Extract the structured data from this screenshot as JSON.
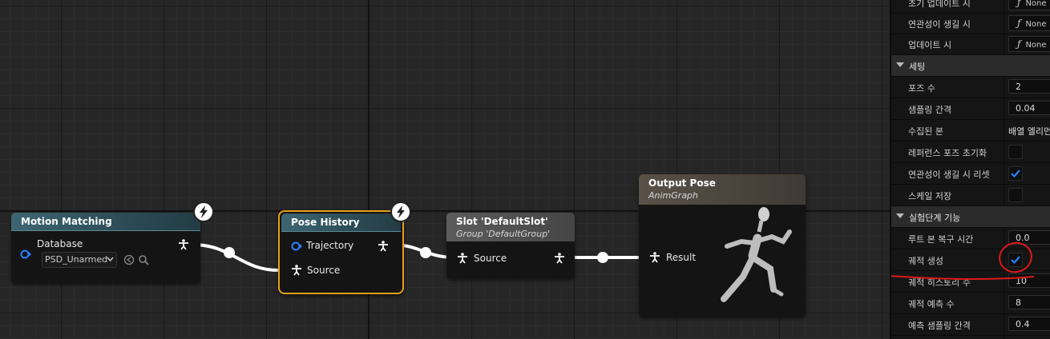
{
  "graph": {
    "nodes": {
      "motion_matching": {
        "title": "Motion Matching",
        "pin_database": "Database",
        "database_value": "PSD_Unarmed"
      },
      "pose_history": {
        "title": "Pose History",
        "pin_trajectory": "Trajectory",
        "pin_source": "Source"
      },
      "slot": {
        "title": "Slot 'DefaultSlot'",
        "subtitle": "Group 'DefaultGroup'",
        "pin_source": "Source"
      },
      "output_pose": {
        "title": "Output Pose",
        "subtitle": "AnimGraph",
        "pin_result": "Result"
      }
    }
  },
  "details": {
    "rows_top": [
      {
        "label": "초기 업데이트 시",
        "value": "None"
      },
      {
        "label": "연관성이 생길 시",
        "value": "None"
      },
      {
        "label": "업데이트 시",
        "value": "None"
      }
    ],
    "section_settings": "세팅",
    "settings_rows": [
      {
        "label": "포즈 수",
        "value": "2"
      },
      {
        "label": "샘플링 간격",
        "value": "0.04"
      },
      {
        "label": "수집된 본",
        "value": "배열 엘리먼트"
      }
    ],
    "check_rows": [
      {
        "label": "레퍼런스 포즈 초기화",
        "checked": false
      },
      {
        "label": "연관성이 생길 시 리셋",
        "checked": true
      },
      {
        "label": "스케일 저장",
        "checked": false
      }
    ],
    "section_experimental": "실험단계 기능",
    "exp_row_1": {
      "label": "루트 본 복구 시간",
      "value": "0.0"
    },
    "exp_row_2": {
      "label": "궤적 생성",
      "checked": true
    },
    "exp_rows_rest": [
      {
        "label": "궤적 히스토리 수",
        "value": "10"
      },
      {
        "label": "궤적 예측 수",
        "value": "8"
      },
      {
        "label": "예측 샘플링 간격",
        "value": "0.4"
      }
    ],
    "function_symbol": "ƒ"
  },
  "colors": {
    "accent_blue": "#2a7fff",
    "selection_orange": "#e8a019",
    "annotation_red": "#e01818",
    "wire_white": "#ffffff"
  }
}
